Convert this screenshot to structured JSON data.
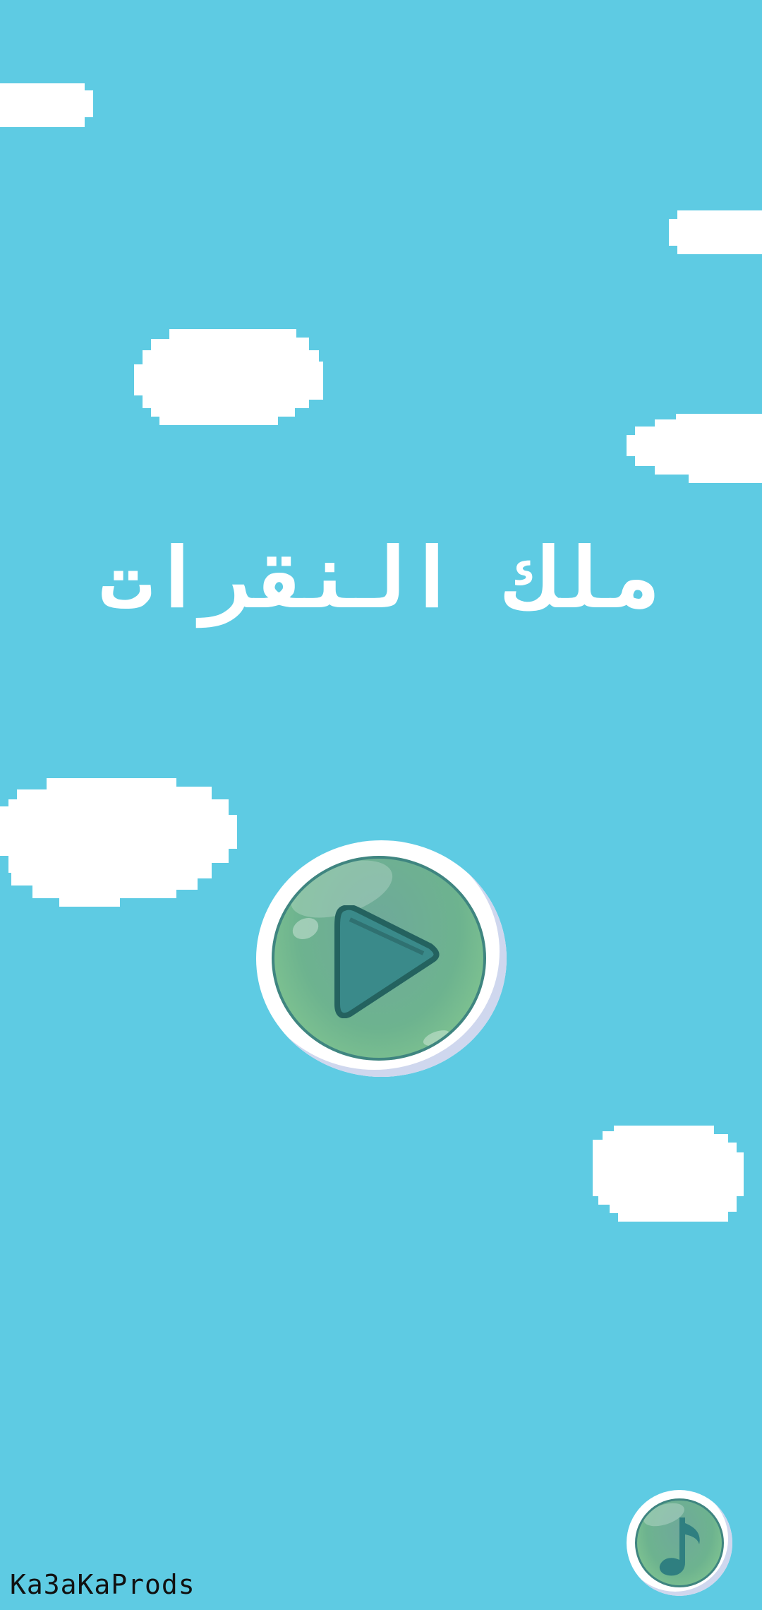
{
  "title": "ملك النقرات",
  "play_button": {
    "icon": "play-icon"
  },
  "music_button": {
    "icon": "music-note-icon"
  },
  "brand": "KaЗaKaProds",
  "colors": {
    "sky": "#5ecbe3",
    "cloud": "#ffffff",
    "button_green": "#6db38f",
    "button_dark": "#3f8580"
  }
}
